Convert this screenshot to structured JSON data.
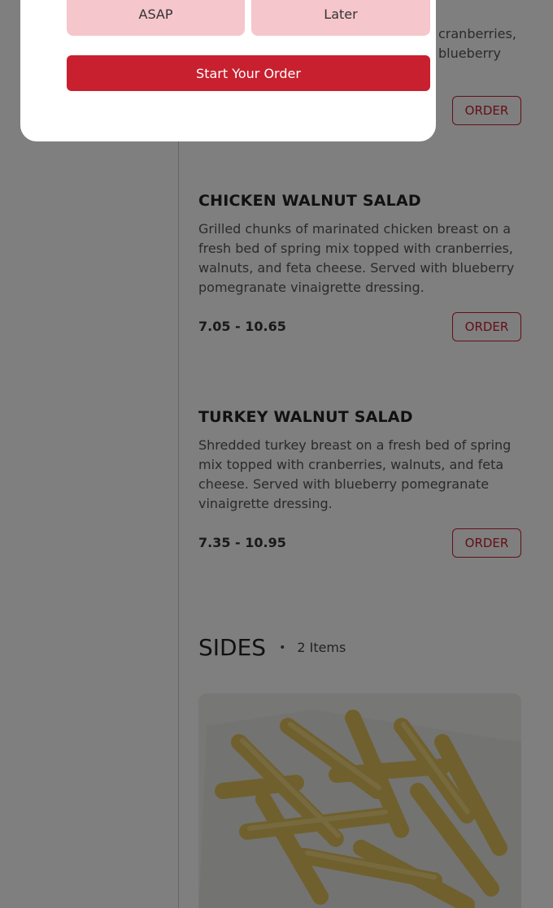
{
  "partial_item": {
    "desc_line_1": "cranberries,",
    "desc_line_2": "blueberry",
    "order_label": "ORDER"
  },
  "items": [
    {
      "title": "CHICKEN WALNUT SALAD",
      "description": "Grilled chunks of marinated chicken breast on a fresh bed of spring mix topped with cranberries, walnuts, and feta cheese. Served with blueberry pomegranate vinaigrette dressing.",
      "price": "7.05 - 10.65",
      "order_label": "ORDER"
    },
    {
      "title": "TURKEY WALNUT SALAD",
      "description": "Shredded turkey breast on a fresh bed of spring mix topped with cranberries, walnuts, and feta cheese. Served with blueberry pomegranate vinaigrette dressing.",
      "price": "7.35 - 10.95",
      "order_label": "ORDER"
    }
  ],
  "sides_section": {
    "title": "SIDES",
    "separator": "•",
    "count": "2 Items",
    "image_icon": "crinkle-fries-photo"
  },
  "modal": {
    "options": [
      {
        "label": "ASAP",
        "icon": "clock-icon",
        "selected": true
      },
      {
        "label": "Later",
        "icon": "calendar-clock-icon",
        "selected": false
      }
    ],
    "start_button": "Start Your Order"
  },
  "colors": {
    "accent": "#c8202f",
    "option_bg": "#f5c6cb",
    "overlay": "rgba(0,0,0,0.5)"
  }
}
